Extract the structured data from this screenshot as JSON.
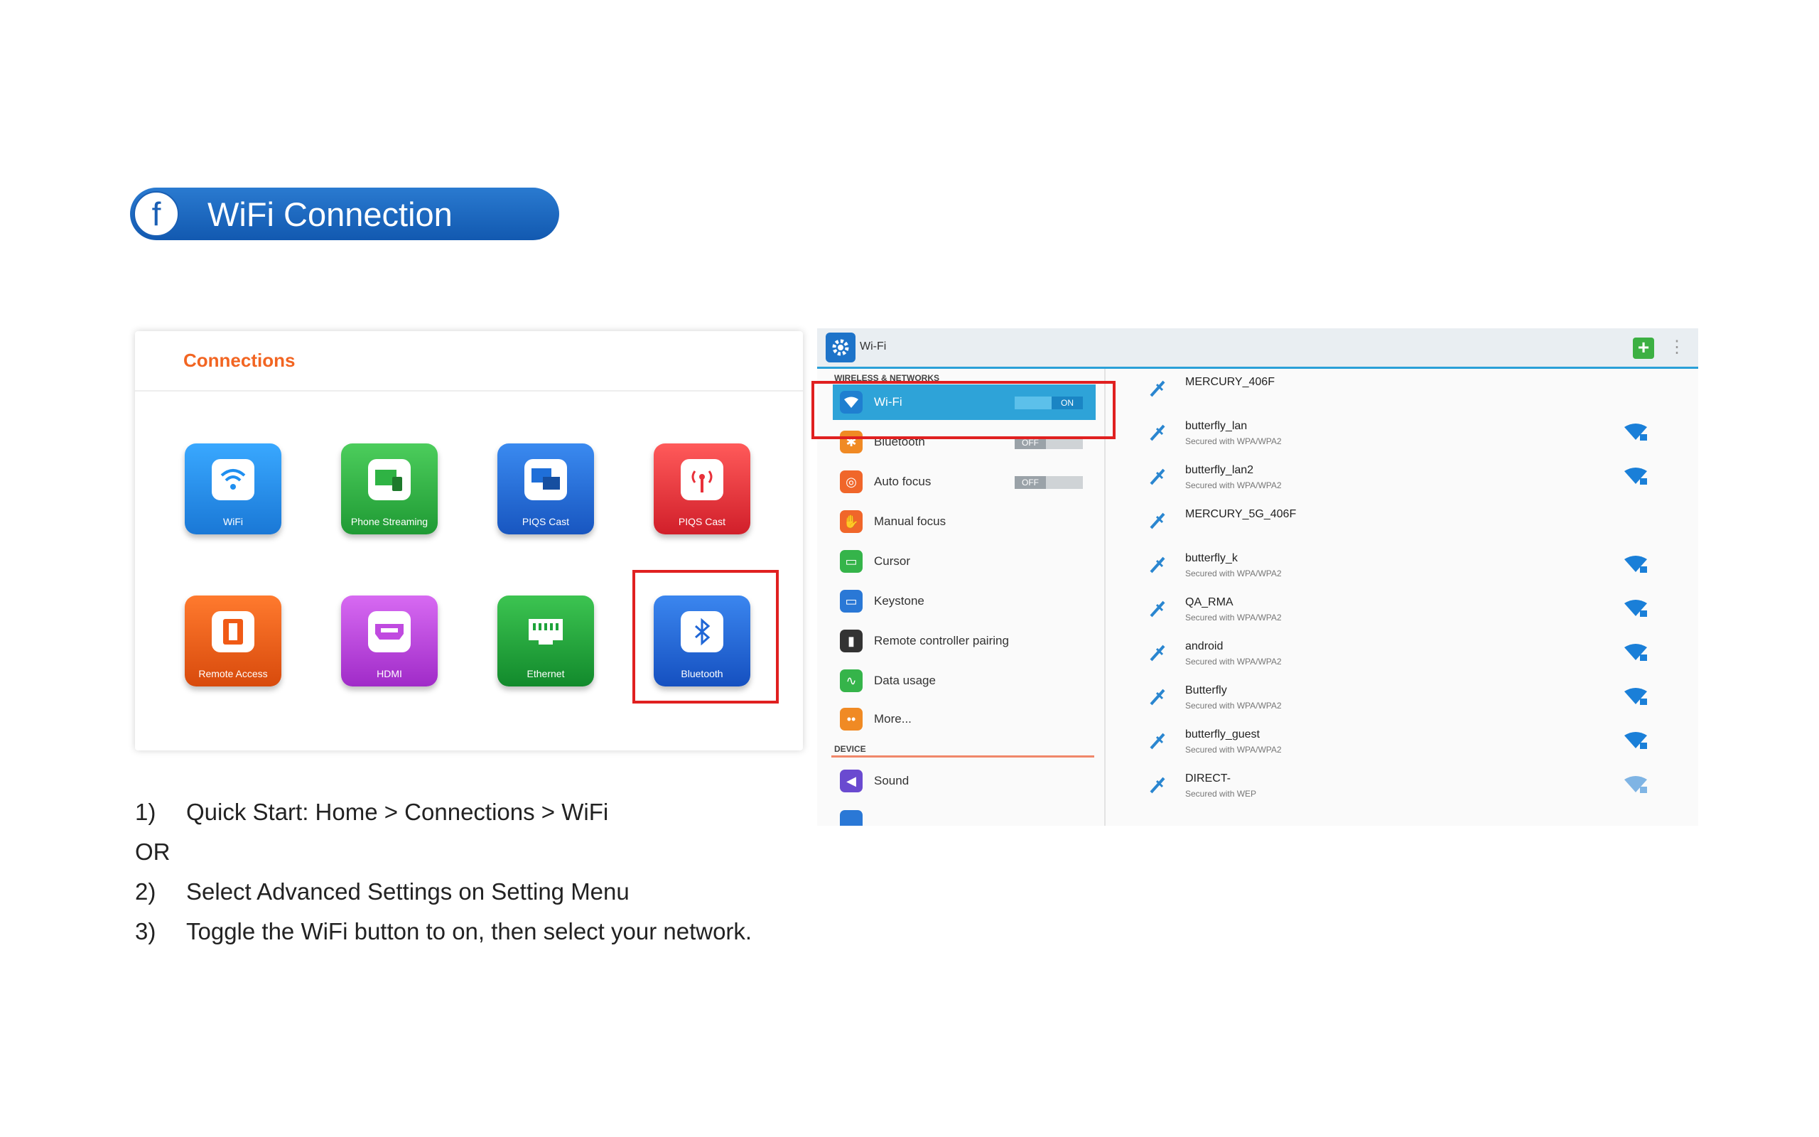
{
  "header": {
    "letter": "f",
    "title": "WiFi Connection"
  },
  "connections": {
    "title": "Connections",
    "tiles": [
      {
        "label": "WiFi",
        "icon": "wifi-icon",
        "color": "#1f8ff0"
      },
      {
        "label": "Phone Streaming",
        "icon": "phone-streaming-icon",
        "color": "#2fb344"
      },
      {
        "label": "PIQS Cast",
        "icon": "cast-icon",
        "color": "#1f6fd8"
      },
      {
        "label": "PIQS Cast",
        "icon": "antenna-icon",
        "color": "#e8303a"
      },
      {
        "label": "Remote Access",
        "icon": "remote-access-icon",
        "color": "#f05a16"
      },
      {
        "label": "HDMI",
        "icon": "hdmi-icon",
        "color": "#c04ae0"
      },
      {
        "label": "Ethernet",
        "icon": "ethernet-icon",
        "color": "#1da33a"
      },
      {
        "label": "Bluetooth",
        "icon": "bluetooth-icon",
        "color": "#1f66d6"
      }
    ]
  },
  "instructions": {
    "step1_num": "1)",
    "step1": "Quick Start: Home > Connections > WiFi",
    "or": "OR",
    "step2_num": "2)",
    "step2": "Select Advanced Settings on Setting Menu",
    "step3_num": "3)",
    "step3": "Toggle the WiFi button to on, then select your network."
  },
  "settings": {
    "title": "Wi-Fi",
    "section_wireless": "WIRELESS & NETWORKS",
    "section_device": "DEVICE",
    "items": [
      {
        "label": "Wi-Fi",
        "icon": "wifi-icon",
        "color": "#1f7fd0",
        "toggle": "ON"
      },
      {
        "label": "Bluetooth",
        "icon": "bluetooth-icon",
        "color": "#f08a24",
        "toggle": "OFF"
      },
      {
        "label": "Auto focus",
        "icon": "focus-icon",
        "color": "#f0662a",
        "toggle": "OFF"
      },
      {
        "label": "Manual focus",
        "icon": "manual-focus-icon",
        "color": "#f0662a"
      },
      {
        "label": "Cursor",
        "icon": "cursor-icon",
        "color": "#35b44a"
      },
      {
        "label": "Keystone",
        "icon": "keystone-icon",
        "color": "#2a78d6"
      },
      {
        "label": "Remote controller pairing",
        "icon": "remote-icon",
        "color": "#333333"
      },
      {
        "label": "Data usage",
        "icon": "data-usage-icon",
        "color": "#35b44a"
      },
      {
        "label": "More...",
        "icon": "more-icon",
        "color": "#f08a24"
      },
      {
        "label": "Sound",
        "icon": "sound-icon",
        "color": "#6a4ad0"
      }
    ],
    "networks": [
      {
        "name": "MERCURY_406F",
        "security": "",
        "locked": false
      },
      {
        "name": "butterfly_lan",
        "security": "Secured with WPA/WPA2",
        "locked": true
      },
      {
        "name": "butterfly_lan2",
        "security": "Secured with WPA/WPA2",
        "locked": true
      },
      {
        "name": "MERCURY_5G_406F",
        "security": "",
        "locked": false
      },
      {
        "name": "butterfly_k",
        "security": "Secured with WPA/WPA2",
        "locked": true
      },
      {
        "name": "QA_RMA",
        "security": "Secured with WPA/WPA2",
        "locked": true
      },
      {
        "name": "android",
        "security": "Secured with WPA/WPA2",
        "locked": true
      },
      {
        "name": "Butterfly",
        "security": "Secured with WPA/WPA2",
        "locked": true
      },
      {
        "name": "butterfly_guest",
        "security": "Secured with WPA/WPA2",
        "locked": true
      },
      {
        "name": "DIRECT-",
        "security": "Secured with WEP",
        "locked": true
      }
    ]
  }
}
